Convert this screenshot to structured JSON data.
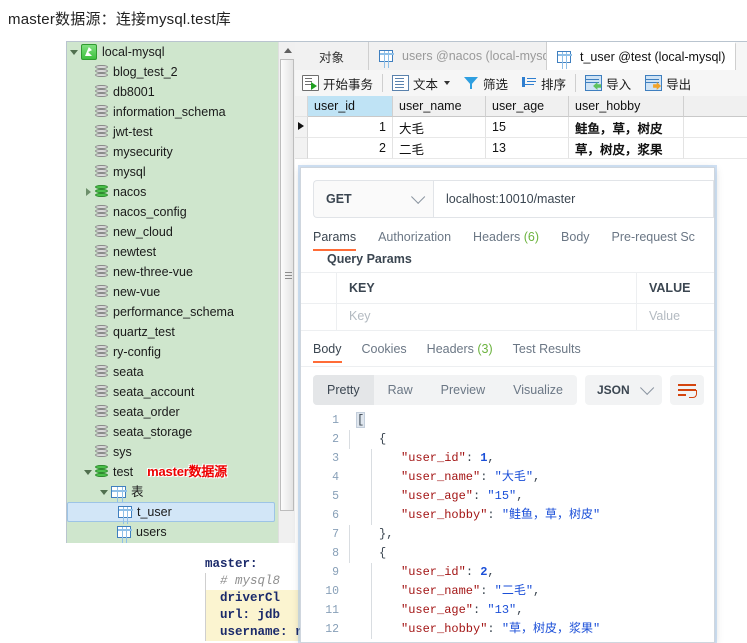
{
  "caption": "master数据源：连接mysql.test库",
  "tree": {
    "connection": {
      "label": "local-mysql",
      "icon": "mysql-connection-icon"
    },
    "databases": [
      {
        "label": "blog_test_2",
        "state": "closed",
        "active": false
      },
      {
        "label": "db8001",
        "state": "closed",
        "active": false
      },
      {
        "label": "information_schema",
        "state": "closed",
        "active": false
      },
      {
        "label": "jwt-test",
        "state": "closed",
        "active": false
      },
      {
        "label": "mysecurity",
        "state": "closed",
        "active": false
      },
      {
        "label": "mysql",
        "state": "closed",
        "active": false
      },
      {
        "label": "nacos",
        "state": "collapsible",
        "active": true
      },
      {
        "label": "nacos_config",
        "state": "closed",
        "active": false
      },
      {
        "label": "new_cloud",
        "state": "closed",
        "active": false
      },
      {
        "label": "newtest",
        "state": "closed",
        "active": false
      },
      {
        "label": "new-three-vue",
        "state": "closed",
        "active": false
      },
      {
        "label": "new-vue",
        "state": "closed",
        "active": false
      },
      {
        "label": "performance_schema",
        "state": "closed",
        "active": false
      },
      {
        "label": "quartz_test",
        "state": "closed",
        "active": false
      },
      {
        "label": "ry-config",
        "state": "closed",
        "active": false
      },
      {
        "label": "seata",
        "state": "closed",
        "active": false
      },
      {
        "label": "seata_account",
        "state": "closed",
        "active": false
      },
      {
        "label": "seata_order",
        "state": "closed",
        "active": false
      },
      {
        "label": "seata_storage",
        "state": "closed",
        "active": false
      },
      {
        "label": "sys",
        "state": "closed",
        "active": false
      }
    ],
    "expanded_db": {
      "label": "test",
      "annotation": "master数据源"
    },
    "tables_folder": "表",
    "tables": [
      {
        "label": "t_user",
        "selected": true
      },
      {
        "label": "users",
        "selected": false
      }
    ]
  },
  "navicat": {
    "tabs": [
      {
        "label": "对象",
        "state": "plain"
      },
      {
        "label": "users @nacos (local-mysql) ...",
        "state": "inactive"
      },
      {
        "label": "t_user @test (local-mysql)",
        "state": "active"
      }
    ],
    "toolbar": [
      {
        "label": "开始事务",
        "icon": "begin-transaction-icon"
      },
      {
        "label": "文本",
        "icon": "text-icon",
        "has_caret": true
      },
      {
        "label": "筛选",
        "icon": "filter-icon"
      },
      {
        "label": "排序",
        "icon": "sort-icon"
      },
      {
        "label": "导入",
        "icon": "import-icon"
      },
      {
        "label": "导出",
        "icon": "export-icon"
      }
    ],
    "grid": {
      "columns": [
        "user_id",
        "user_name",
        "user_age",
        "user_hobby"
      ],
      "rows": [
        {
          "current": true,
          "user_id": "1",
          "user_name": "大毛",
          "user_age": "15",
          "user_hobby": "鲑鱼，草，树皮"
        },
        {
          "current": false,
          "user_id": "2",
          "user_name": "二毛",
          "user_age": "13",
          "user_hobby": "草，树皮，浆果"
        }
      ]
    }
  },
  "code_snippet": {
    "lines": [
      {
        "text": "master:",
        "style": "kw"
      },
      {
        "text": "  # mysql8",
        "style": "cmt"
      },
      {
        "text": "  driverCl",
        "style": "kw-hl"
      },
      {
        "text": "  url: jdb",
        "style": "kw-hl"
      },
      {
        "text": "  username: root",
        "style": "kw-hl"
      }
    ]
  },
  "postman": {
    "method": "GET",
    "url": "localhost:10010/master",
    "request_tabs": [
      {
        "label": "Params",
        "count": "",
        "active": true
      },
      {
        "label": "Authorization",
        "count": "",
        "active": false
      },
      {
        "label": "Headers",
        "count": "(6)",
        "active": false
      },
      {
        "label": "Body",
        "count": "",
        "active": false
      },
      {
        "label": "Pre-request Sc",
        "count": "",
        "active": false
      }
    ],
    "query_params_label": "Query Params",
    "params_table": {
      "headers": [
        "KEY",
        "VALUE"
      ],
      "placeholder_row": {
        "key": "Key",
        "value": "Value"
      }
    },
    "response_tabs": [
      {
        "label": "Body",
        "count": "",
        "active": true
      },
      {
        "label": "Cookies",
        "count": "",
        "active": false
      },
      {
        "label": "Headers",
        "count": "(3)",
        "active": false
      },
      {
        "label": "Test Results",
        "count": "",
        "active": false
      }
    ],
    "format_segments": [
      {
        "label": "Pretty",
        "active": true
      },
      {
        "label": "Raw",
        "active": false
      },
      {
        "label": "Preview",
        "active": false
      },
      {
        "label": "Visualize",
        "active": false
      }
    ],
    "content_type": "JSON",
    "wrap_icon": "wrap-lines-icon",
    "response_lines": [
      {
        "n": "1",
        "indent": 0,
        "segments": [
          {
            "t": "[",
            "c": "jp"
          }
        ]
      },
      {
        "n": "2",
        "indent": 1,
        "segments": [
          {
            "t": "{",
            "c": "jp"
          }
        ]
      },
      {
        "n": "3",
        "indent": 2,
        "segments": [
          {
            "t": "\"user_id\"",
            "c": "jk"
          },
          {
            "t": ": ",
            "c": "jp"
          },
          {
            "t": "1",
            "c": "jn"
          },
          {
            "t": ",",
            "c": "jp"
          }
        ]
      },
      {
        "n": "4",
        "indent": 2,
        "segments": [
          {
            "t": "\"user_name\"",
            "c": "jk"
          },
          {
            "t": ": ",
            "c": "jp"
          },
          {
            "t": "\"大毛\"",
            "c": "js"
          },
          {
            "t": ",",
            "c": "jp"
          }
        ]
      },
      {
        "n": "5",
        "indent": 2,
        "segments": [
          {
            "t": "\"user_age\"",
            "c": "jk"
          },
          {
            "t": ": ",
            "c": "jp"
          },
          {
            "t": "\"15\"",
            "c": "js"
          },
          {
            "t": ",",
            "c": "jp"
          }
        ]
      },
      {
        "n": "6",
        "indent": 2,
        "segments": [
          {
            "t": "\"user_hobby\"",
            "c": "jk"
          },
          {
            "t": ": ",
            "c": "jp"
          },
          {
            "t": "\"鲑鱼，草，树皮\"",
            "c": "js"
          }
        ]
      },
      {
        "n": "7",
        "indent": 1,
        "segments": [
          {
            "t": "},",
            "c": "jp"
          }
        ]
      },
      {
        "n": "8",
        "indent": 1,
        "segments": [
          {
            "t": "{",
            "c": "jp"
          }
        ]
      },
      {
        "n": "9",
        "indent": 2,
        "segments": [
          {
            "t": "\"user_id\"",
            "c": "jk"
          },
          {
            "t": ": ",
            "c": "jp"
          },
          {
            "t": "2",
            "c": "jn"
          },
          {
            "t": ",",
            "c": "jp"
          }
        ]
      },
      {
        "n": "10",
        "indent": 2,
        "segments": [
          {
            "t": "\"user_name\"",
            "c": "jk"
          },
          {
            "t": ": ",
            "c": "jp"
          },
          {
            "t": "\"二毛\"",
            "c": "js"
          },
          {
            "t": ",",
            "c": "jp"
          }
        ]
      },
      {
        "n": "11",
        "indent": 2,
        "segments": [
          {
            "t": "\"user_age\"",
            "c": "jk"
          },
          {
            "t": ": ",
            "c": "jp"
          },
          {
            "t": "\"13\"",
            "c": "js"
          },
          {
            "t": ",",
            "c": "jp"
          }
        ]
      },
      {
        "n": "12",
        "indent": 2,
        "segments": [
          {
            "t": "\"user_hobby\"",
            "c": "jk"
          },
          {
            "t": ": ",
            "c": "jp"
          },
          {
            "t": "\"草，树皮，浆果\"",
            "c": "js"
          }
        ]
      }
    ]
  },
  "colors": {
    "tree_bg": "#cfe6cd",
    "annotation_red": "#ee0000",
    "postman_accent": "#ff6c37",
    "selected_row": "#d2e6f7",
    "selected_header": "#bfe3f5"
  }
}
